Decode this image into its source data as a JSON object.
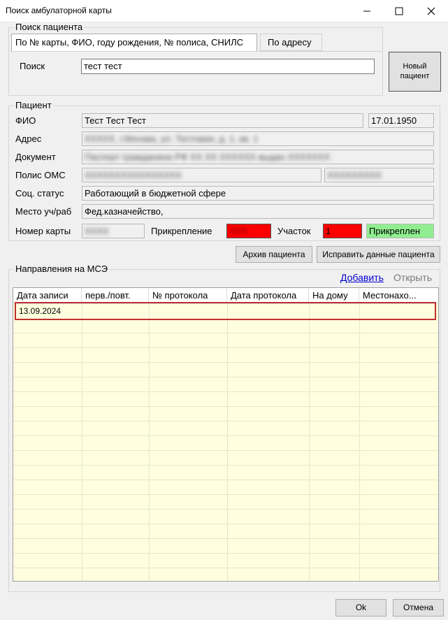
{
  "window": {
    "title": "Поиск амбулаторной карты",
    "controls": [
      "minimize-icon",
      "maximize-icon",
      "close-icon"
    ]
  },
  "search": {
    "group_title": "Поиск пациента",
    "tabs": [
      {
        "label": "По № карты, ФИО, году рождения, № полиса, СНИЛС",
        "active": true
      },
      {
        "label": "По адресу",
        "active": false
      }
    ],
    "query_label": "Поиск",
    "query_value": "тест тест",
    "new_patient_label": "Новый пациент"
  },
  "patient": {
    "group_title": "Пациент",
    "fio_label": "ФИО",
    "fio_value": "Тест Тест Тест",
    "birth_date": "17.01.1950",
    "address_label": "Адрес",
    "address_value": "XXXXX, г.Москва, ул. Тестовая, д. 1, кв. 1",
    "document_label": "Документ",
    "document_value": "Паспорт гражданина РФ XX XX XXXXXX выдан XXXXXXX",
    "oms_label": "Полис ОМС",
    "oms_value": "XXXXXXXXXXXXXXXX",
    "oms_extra": "XXXXXXXXX",
    "social_label": "Соц. статус",
    "social_value": "Работающий в бюджетной сфере",
    "work_label": "Место уч/раб",
    "work_value": "Фед.казначейство,",
    "card_label": "Номер карты",
    "card_value": "XXXX",
    "attach_label": "Прикрепление",
    "attach_value": "XXX",
    "district_label": "Участок",
    "district_value": "1",
    "status_value": "Прикреплен",
    "colors": {
      "red": "#ff0000",
      "green": "#90ee90"
    }
  },
  "actions": {
    "archive_label": "Архив пациента",
    "fix_label": "Исправить данные пациента"
  },
  "mse": {
    "group_title": "Направления на МСЭ",
    "add_link": "Добавить",
    "open_link": "Открыть",
    "columns": [
      "Дата записи",
      "перв./повт.",
      "№ протокола",
      "Дата протокола",
      "На дому",
      "Местонахо..."
    ],
    "rows": [
      [
        "13.09.2024",
        "",
        "",
        "",
        "",
        ""
      ]
    ]
  },
  "footer": {
    "ok_label": "Ok",
    "cancel_label": "Отмена"
  }
}
